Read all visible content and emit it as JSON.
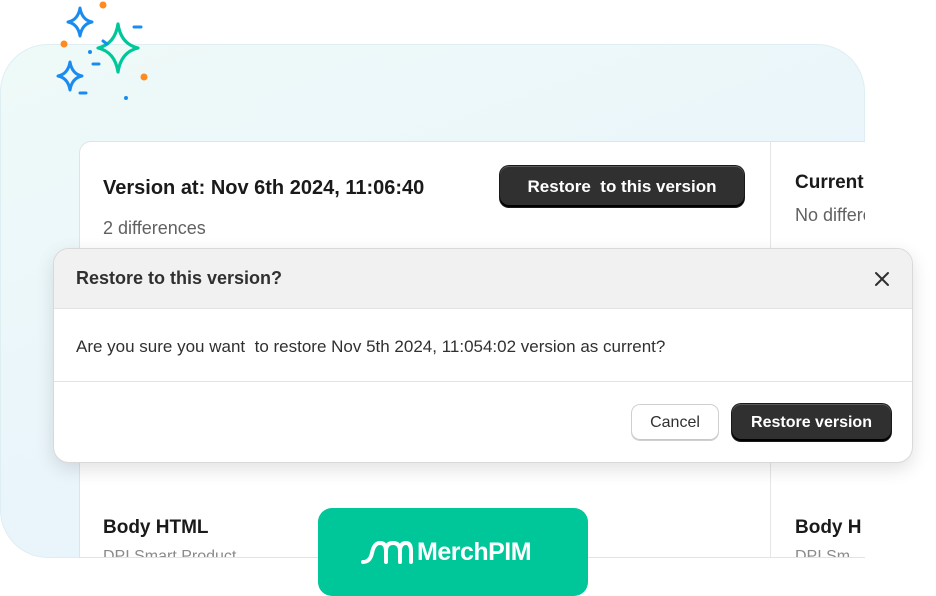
{
  "panel": {
    "version_title": "Version at: Nov 6th 2024, 11:06:40",
    "differences": "2 differences",
    "restore_button": "Restore  to this version",
    "current_title": "Current",
    "current_subtitle": "No differe",
    "body_title": "Body HTML",
    "body_subtitle": "DPI Smart Product",
    "body_title_right": "Body H",
    "body_subtitle_right": "DPI Sm"
  },
  "modal": {
    "title": "Restore to this version?",
    "message": "Are you sure you want  to restore Nov 5th 2024, 11:054:02 version as current?",
    "cancel_label": "Cancel",
    "confirm_label": "Restore version",
    "close_icon": "close-icon"
  },
  "brand": {
    "name": "MerchPIM",
    "logo_icon": "merchpim-logo-icon",
    "color": "#00c79a"
  },
  "decorations": {
    "icon": "sparkles-icon",
    "colors": [
      "#1a8cf0",
      "#00c79a",
      "#ff8a1f"
    ]
  }
}
